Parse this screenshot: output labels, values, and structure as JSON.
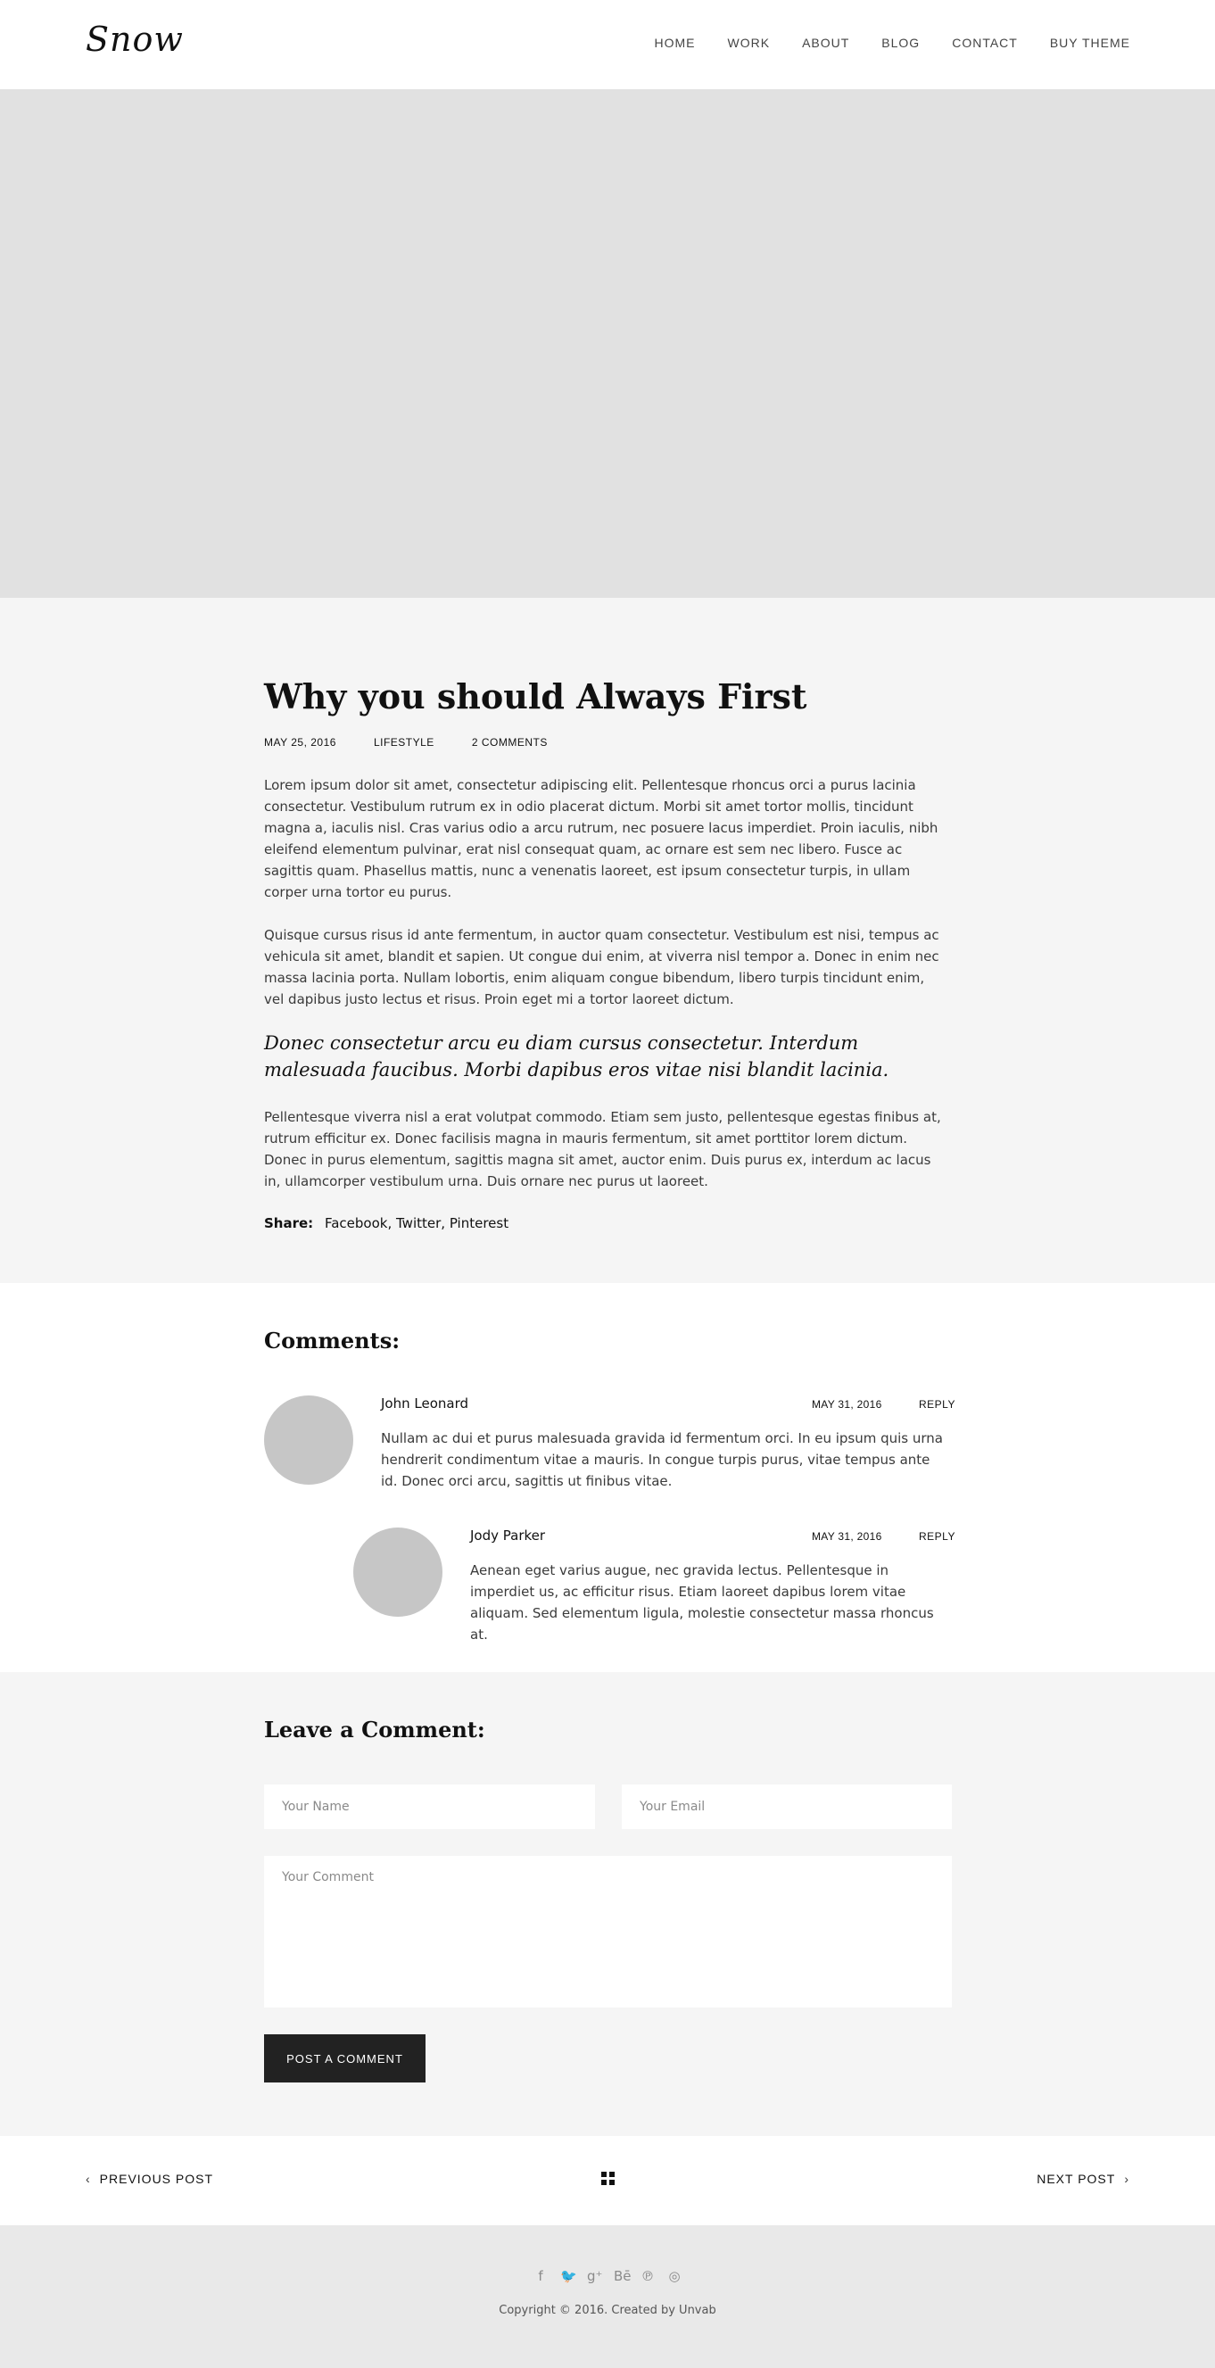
{
  "header": {
    "logo": "Snow",
    "nav": [
      "HOME",
      "WORK",
      "ABOUT",
      "BLOG",
      "CONTACT",
      "BUY THEME"
    ]
  },
  "post": {
    "title": "Why you should Always First",
    "date": "MAY 25, 2016",
    "category": "LIFESTYLE",
    "comments_count": "2 COMMENTS",
    "paragraph1": "Lorem ipsum dolor sit amet, consectetur adipiscing elit. Pellentesque rhoncus orci a purus lacinia consectetur. Vestibulum rutrum ex in odio placerat dictum. Morbi sit amet tortor mollis, tincidunt magna a, iaculis nisl. Cras varius odio a arcu rutrum, nec posuere lacus imperdiet. Proin iaculis, nibh eleifend elementum pulvinar, erat nisl consequat quam, ac ornare est sem nec libero. Fusce ac sagittis quam. Phasellus mattis, nunc a venenatis laoreet, est ipsum consectetur turpis, in ullam corper urna tortor eu purus.",
    "paragraph2": "Quisque cursus risus id ante fermentum, in auctor quam consectetur. Vestibulum est nisi, tempus ac vehicula sit amet, blandit et sapien. Ut congue dui enim, at viverra nisl tempor a. Donec in enim nec massa lacinia porta. Nullam lobortis, enim aliquam congue bibendum, libero turpis tincidunt enim, vel dapibus justo lectus et risus. Proin eget mi a tortor laoreet dictum.",
    "quote": "Donec consectetur arcu eu diam cursus consectetur. Interdum malesuada faucibus. Morbi dapibus eros vitae nisi blandit lacinia.",
    "paragraph3": "Pellentesque viverra nisl a erat volutpat commodo. Etiam sem justo, pellentesque egestas finibus at, rutrum efficitur ex. Donec facilisis magna in mauris fermentum, sit amet porttitor lorem dictum. Donec in purus elementum, sagittis magna sit amet, auctor enim. Duis purus ex, interdum ac lacus in, ullamcorper vestibulum urna. Duis ornare nec purus ut laoreet.",
    "share_label": "Share:",
    "share_links": [
      "Facebook",
      "Twitter",
      "Pinterest"
    ]
  },
  "comments": {
    "title": "Comments:",
    "items": [
      {
        "name": "John Leonard",
        "date": "MAY 31, 2016",
        "reply": "REPLY",
        "text": "Nullam ac dui et purus malesuada gravida id fermentum orci. In eu ipsum quis urna hendrerit condimentum vitae a mauris. In congue turpis purus, vitae tempus ante id. Donec orci arcu, sagittis ut finibus vitae."
      },
      {
        "name": "Jody Parker",
        "date": "MAY 31, 2016",
        "reply": "REPLY",
        "text": "Aenean eget varius augue, nec gravida lectus. Pellentesque in imperdiet us, ac efficitur risus. Etiam laoreet dapibus lorem vitae aliquam. Sed elementum ligula, molestie consectetur massa rhoncus at."
      }
    ]
  },
  "leave_comment": {
    "title": "Leave a Comment:",
    "name_placeholder": "Your Name",
    "email_placeholder": "Your Email",
    "comment_placeholder": "Your Comment",
    "submit_label": "POST A COMMENT"
  },
  "post_nav": {
    "prev_label": "PREVIOUS POST",
    "next_label": "NEXT POST"
  },
  "footer": {
    "social_icons": [
      "facebook-icon",
      "twitter-icon",
      "google-plus-icon",
      "behance-icon",
      "pinterest-icon",
      "instagram-icon"
    ],
    "social_glyphs": [
      "f",
      "🐦",
      "g⁺",
      "Bē",
      "℗",
      "◎"
    ],
    "copyright": "Copyright © 2016. Created by Unvab"
  }
}
